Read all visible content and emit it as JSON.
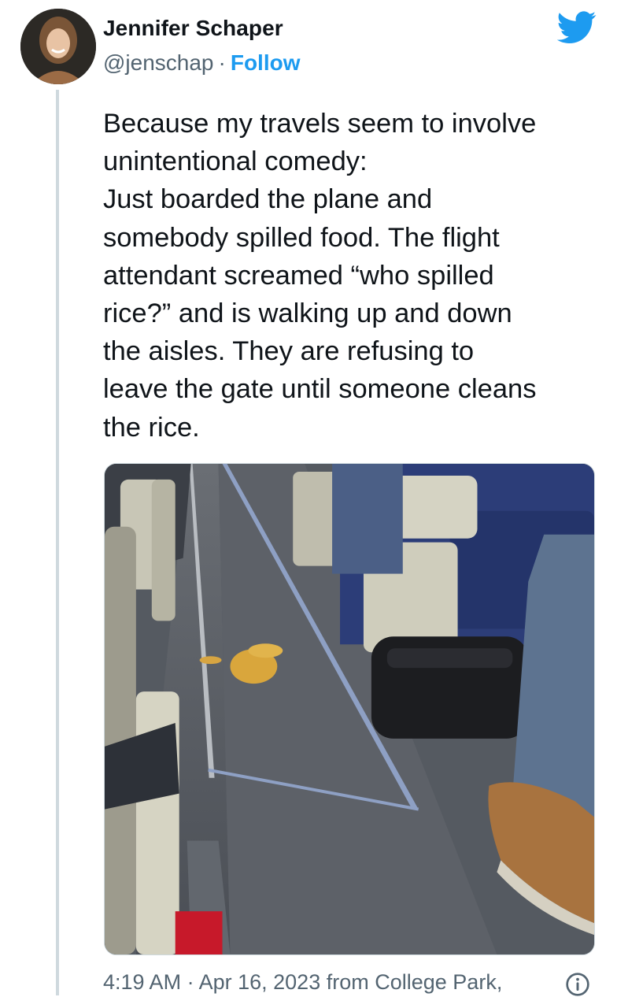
{
  "author": {
    "name": "Jennifer Schaper",
    "handle": "@jenschap",
    "separator": "·",
    "follow_label": "Follow"
  },
  "tweet": {
    "text": "Because my travels seem to involve\nunintentional comedy:\nJust boarded the plane and\nsomebody spilled food. The flight\nattendant screamed “who spilled\nrice?” and is walking up and down\nthe aisles. They are refusing to\nleave the gate until someone cleans\nthe rice."
  },
  "meta": {
    "time": "4:19 AM",
    "separator": "·",
    "date": "Apr 16, 2023",
    "source": "from College Park,"
  },
  "icons": {
    "brand": "twitter-bird-icon",
    "info": "info-icon"
  },
  "colors": {
    "accent": "#1d9bf0",
    "secondary_text": "#536471",
    "thread_line": "#cfd9de"
  }
}
